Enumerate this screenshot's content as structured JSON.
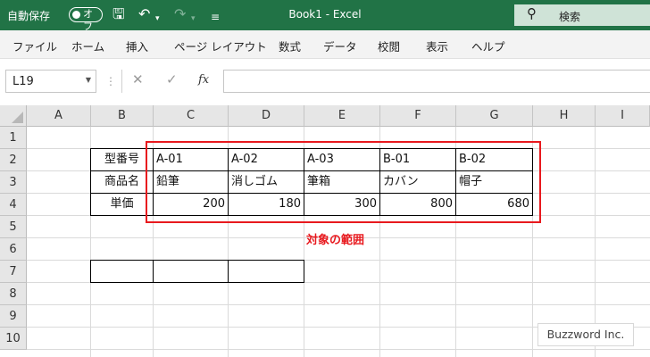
{
  "titlebar": {
    "autosave_label": "自動保存",
    "autosave_state": "オフ",
    "title": "Book1  -  Excel",
    "search_label": "検索",
    "background_color": "#217346",
    "icons": [
      "save-icon",
      "undo-icon",
      "redo-icon",
      "customize-quick-access-icon",
      "search-icon"
    ]
  },
  "menu": {
    "items": [
      "ファイル",
      "ホーム",
      "挿入",
      "ページ レイアウト",
      "数式",
      "データ",
      "校閲",
      "表示",
      "ヘルプ"
    ]
  },
  "formula_bar": {
    "name_box": "L19",
    "cancel_icon": "✕",
    "enter_icon": "✓",
    "fx_label": "fx",
    "formula": ""
  },
  "sheet": {
    "columns": [
      "A",
      "B",
      "C",
      "D",
      "E",
      "F",
      "G",
      "H",
      "I"
    ],
    "rows": [
      "1",
      "2",
      "3",
      "4",
      "5",
      "6",
      "7",
      "8",
      "9",
      "10"
    ],
    "table": {
      "row_headers": [
        "型番号",
        "商品名",
        "単価"
      ],
      "model_numbers": [
        "A-01",
        "A-02",
        "A-03",
        "B-01",
        "B-02"
      ],
      "product_names": [
        "鉛筆",
        "消しゴム",
        "筆箱",
        "カバン",
        "帽子"
      ],
      "unit_prices": [
        "200",
        "180",
        "300",
        "800",
        "680"
      ]
    },
    "annotation": "対象の範囲",
    "highlight_color": "#e8191e"
  },
  "watermark": "Buzzword Inc."
}
